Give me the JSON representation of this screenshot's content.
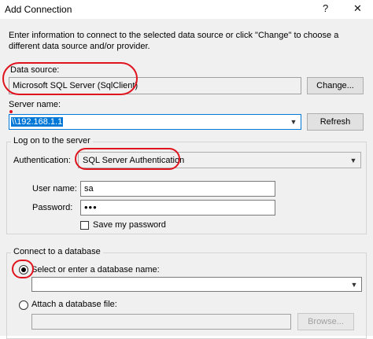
{
  "window": {
    "title": "Add Connection",
    "help_symbol": "?",
    "close_symbol": "✕"
  },
  "description": "Enter information to connect to the selected data source or click \"Change\" to choose a different data source and/or provider.",
  "data_source": {
    "label": "Data source:",
    "value": "Microsoft SQL Server (SqlClient)",
    "change_label": "Change..."
  },
  "server": {
    "label": "Server name:",
    "value": "\\\\192.168.1.1",
    "refresh_label": "Refresh"
  },
  "logon": {
    "group_label": "Log on to the server",
    "auth_label": "Authentication:",
    "auth_value": "SQL Server Authentication",
    "user_label": "User name:",
    "user_value": "sa",
    "password_label": "Password:",
    "password_value": "•••",
    "save_password_label": "Save my password"
  },
  "database": {
    "group_label": "Connect to a database",
    "select_label": "Select or enter a database name:",
    "select_value": "",
    "attach_label": "Attach a database file:",
    "attach_value": "",
    "browse_label": "Browse..."
  },
  "colors": {
    "annotation": "#e0141e",
    "accent": "#0078d7"
  }
}
